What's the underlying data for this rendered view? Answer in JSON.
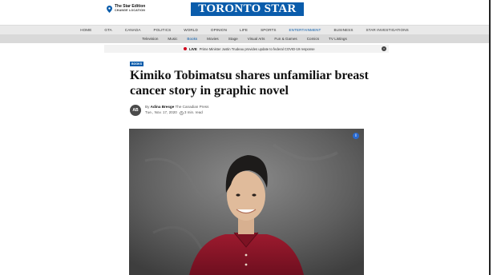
{
  "edition": {
    "name": "The Star Edition",
    "change_location": "CHANGE LOCATION",
    "icon": "location-pin-icon"
  },
  "logo": {
    "text": "TORONTO STAR"
  },
  "nav": {
    "items": [
      "HOME",
      "GTA",
      "CANADA",
      "POLITICS",
      "WORLD",
      "OPINION",
      "LIFE",
      "SPORTS",
      "ENTERTAINMENT",
      "BUSINESS",
      "STAR INVESTIGATIONS"
    ],
    "active": "ENTERTAINMENT"
  },
  "subnav": {
    "items": [
      "Television",
      "Music",
      "Books",
      "Movies",
      "Stage",
      "Visual Arts",
      "Fun & Games",
      "Comics",
      "TV Listings"
    ],
    "active": "Books"
  },
  "live": {
    "label": "LIVE",
    "text": "Prime Minister Justin Trudeau provides update to federal COVID-19 response",
    "close": "×"
  },
  "article": {
    "section": "BOOKS",
    "headline": "Kimiko Tobimatsu shares unfamiliar breast cancer story in graphic novel",
    "avatar_initials": "AB",
    "by_prefix": "By",
    "author": "Adina Bresge",
    "source": "The Canadian Press",
    "date": "Tue., Nov. 17, 2020",
    "read_time": "3 min. read",
    "info_icon": "i"
  },
  "colors": {
    "brand_blue": "#0a5cab",
    "live_red": "#d0021b",
    "photo_shirt": "#8e1426"
  }
}
